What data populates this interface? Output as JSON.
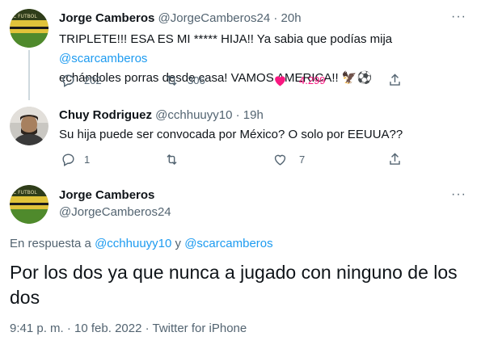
{
  "tweets": [
    {
      "name": "Jorge Camberos",
      "handle": "@JorgeCamberos24",
      "sep": "·",
      "time": "20h",
      "text_1": "TRIPLETE!!! ESA ES MI ***** HIJA!! Ya sabia que podías mija ",
      "mention": "@scarcamberos",
      "text_2": "echándoles porras desde casa! VAMOS AMERICA!! 🦅⚽",
      "replies": "202",
      "retweets": "306",
      "likes": "4.299"
    },
    {
      "name": "Chuy Rodriguez",
      "handle": "@cchhuuyy10",
      "sep": "·",
      "time": "19h",
      "text": "Su hija puede ser convocada por México? O solo por EEUUA??",
      "replies": "1",
      "retweets": "",
      "likes": "7"
    }
  ],
  "main_tweet": {
    "name": "Jorge Camberos",
    "handle": "@JorgeCamberos24",
    "reply_prefix": "En respuesta a ",
    "reply_mention_1": "@cchhuuyy10",
    "reply_and": " y ",
    "reply_mention_2": "@scarcamberos",
    "text": "Por los dos ya que nunca a jugado con ninguno de los dos",
    "timestamp": "9:41 p. m. · 10 feb. 2022 · ",
    "source": "Twitter for iPhone"
  },
  "icons": {
    "reply": "reply-icon",
    "retweet": "retweet-icon",
    "like": "heart-icon",
    "share": "share-icon",
    "more": "more-icon"
  },
  "colors": {
    "accent": "#1d9bf0",
    "like": "#f91880",
    "secondary_text": "#536471",
    "thread_line": "#cfd9de"
  }
}
